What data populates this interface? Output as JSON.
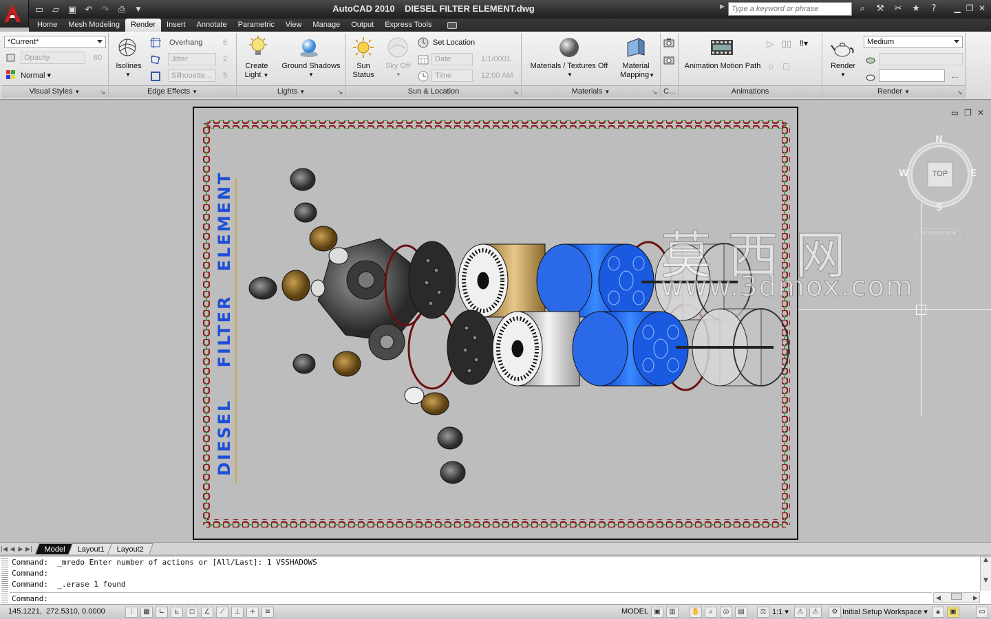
{
  "window": {
    "title": "AutoCAD 2010    DIESEL FILTER ELEMENT.dwg"
  },
  "search": {
    "placeholder": "Type a keyword or phrase"
  },
  "ribbon_tabs": [
    "Home",
    "Mesh Modeling",
    "Render",
    "Insert",
    "Annotate",
    "Parametric",
    "View",
    "Manage",
    "Output",
    "Express Tools"
  ],
  "active_tab": "Render",
  "visual_styles": {
    "current": "*Current*",
    "opacity_label": "Opacity",
    "opacity_value": "60",
    "face_style": "Normal",
    "title": "Visual Styles"
  },
  "edge_effects": {
    "isolines": "Isolines",
    "overhang_label": "Overhang",
    "overhang_value": "6",
    "jitter_label": "Jitter",
    "jitter_value": "2",
    "silhouette_label": "Silhouette...",
    "silhouette_value": "5",
    "title": "Edge Effects"
  },
  "lights": {
    "create_light_line1": "Create",
    "create_light_line2": "Light",
    "ground_shadows": "Ground Shadows",
    "title": "Lights"
  },
  "sun_location": {
    "sun_status_line1": "Sun",
    "sun_status_line2": "Status",
    "sky_off": "Sky Off",
    "set_location": "Set Location",
    "date_label": "Date",
    "date_value": "1/1/0001",
    "time_label": "Time",
    "time_value": "12:00 AM",
    "title": "Sun & Location"
  },
  "materials": {
    "materials_textures": "Materials / Textures Off",
    "material_mapping_line1": "Material",
    "material_mapping_line2": "Mapping",
    "title": "Materials"
  },
  "camera": {
    "title": "C..."
  },
  "animations": {
    "motion_path": "Animation Motion Path",
    "title": "Animations"
  },
  "render": {
    "render_label": "Render",
    "quality": "Medium",
    "more": "...",
    "title": "Render"
  },
  "drawing": {
    "vertical_text_1": "DIESEL",
    "vertical_text_2": "FILTER",
    "vertical_text_3": "ELEMENT"
  },
  "watermark": {
    "chinese": "莫 西 网",
    "url": "www.3dmox.com"
  },
  "viewcube": {
    "north": "N",
    "south": "S",
    "east": "E",
    "west": "W",
    "face": "TOP",
    "ucs": "Unnamed"
  },
  "layout_tabs": [
    "Model",
    "Layout1",
    "Layout2"
  ],
  "active_layout": "Model",
  "command_history": [
    "Command:  _mredo Enter number of actions or [All/Last]: 1 VSSHADOWS",
    "Command:",
    "Command:  _.erase 1 found"
  ],
  "command_prompt": "Command:",
  "status": {
    "coords": "145.1221,  272.5310, 0.0000",
    "model": "MODEL",
    "scale": "1:1",
    "workspace": "Initial Setup Workspace"
  },
  "colors": {
    "accent_blue": "#1f4fd8",
    "title_bar": "#2a2a2a",
    "viewport_bg": "#bfbfbf",
    "frame_red": "#8a1c1c",
    "frame_green": "#3fa33f"
  }
}
